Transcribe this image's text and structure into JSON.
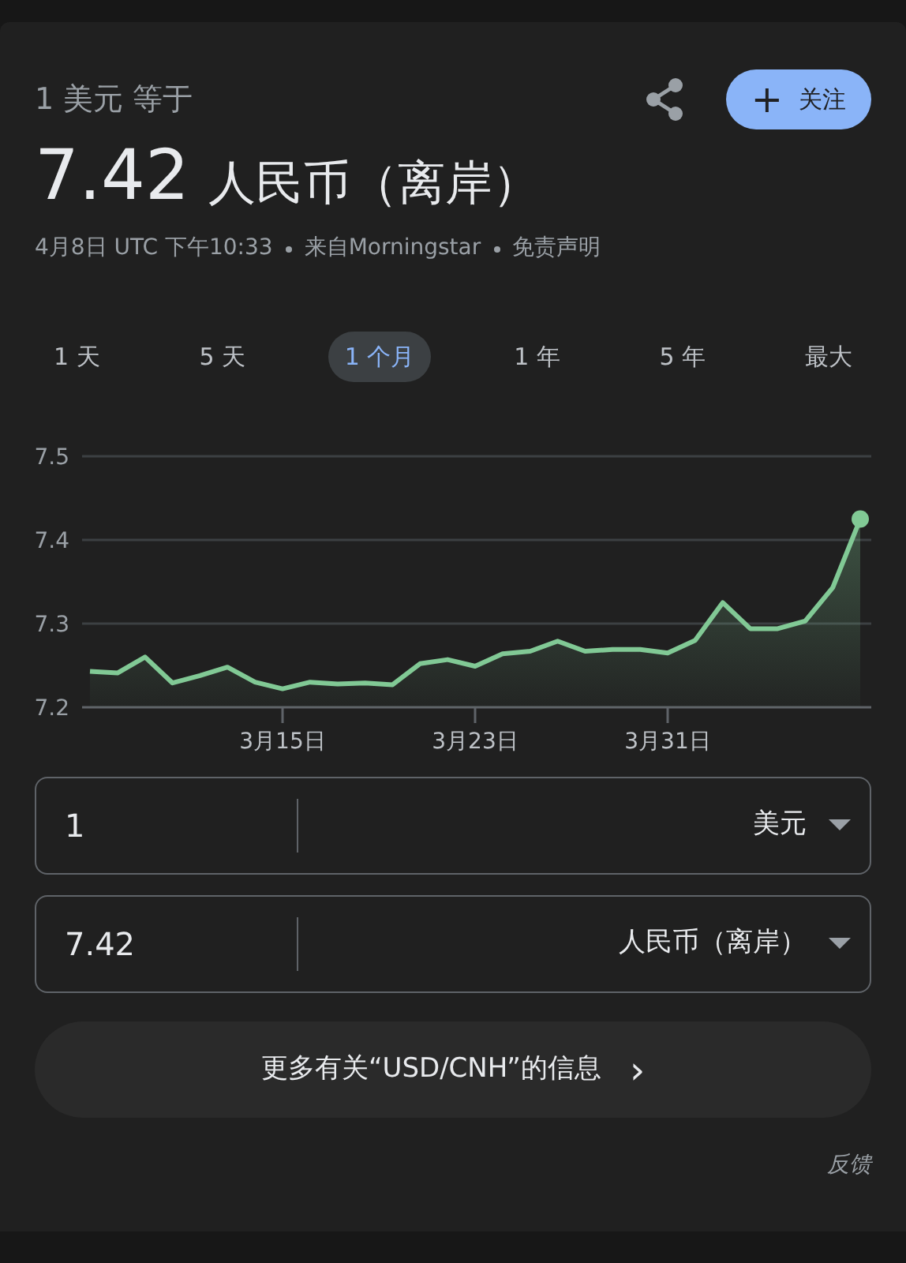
{
  "header": {
    "label": "1 美元 等于",
    "amount": "7.42",
    "currency": "人民币（离岸）",
    "follow_button": "关注",
    "follow_icon": "+"
  },
  "meta": [
    "4月8日 UTC 下午10:33",
    "来自Morningstar",
    "免责声明"
  ],
  "ranges": [
    {
      "label": "1 天",
      "selected": false
    },
    {
      "label": "5 天",
      "selected": false
    },
    {
      "label": "1 个月",
      "selected": true
    },
    {
      "label": "1 年",
      "selected": false
    },
    {
      "label": "5 年",
      "selected": false
    },
    {
      "label": "最大",
      "selected": false
    }
  ],
  "chart_data": {
    "type": "area",
    "categories": [
      null,
      null,
      null,
      null,
      null,
      null,
      null,
      "3月15日",
      null,
      null,
      null,
      null,
      null,
      null,
      "3月23日",
      null,
      null,
      null,
      null,
      null,
      null,
      "3月31日",
      null,
      null,
      null,
      null,
      null,
      null,
      null
    ],
    "series": [
      {
        "color": "#81c995",
        "values": [
          7.243,
          7.241,
          7.26,
          7.229,
          7.238,
          7.248,
          7.23,
          7.222,
          7.23,
          7.228,
          7.229,
          7.227,
          7.252,
          7.257,
          7.249,
          7.264,
          7.267,
          7.279,
          7.267,
          7.269,
          7.269,
          7.265,
          7.28,
          7.325,
          7.294,
          7.294,
          7.303,
          7.343,
          7.425
        ]
      }
    ],
    "ylim": [
      7.2,
      7.5
    ],
    "yticks": [
      {
        "value": 7.2,
        "label": "7.2"
      },
      {
        "value": 7.3,
        "label": "7.3"
      },
      {
        "value": 7.4,
        "label": "7.4"
      },
      {
        "value": 7.5,
        "label": "7.5"
      }
    ]
  },
  "converter": [
    {
      "value": "1",
      "currency": "美元"
    },
    {
      "value": "7.42",
      "currency": "人民币（离岸）"
    }
  ],
  "more_button": "更多有关“USD/CNH”的信息",
  "more_icon": "›",
  "feedback": "反馈"
}
